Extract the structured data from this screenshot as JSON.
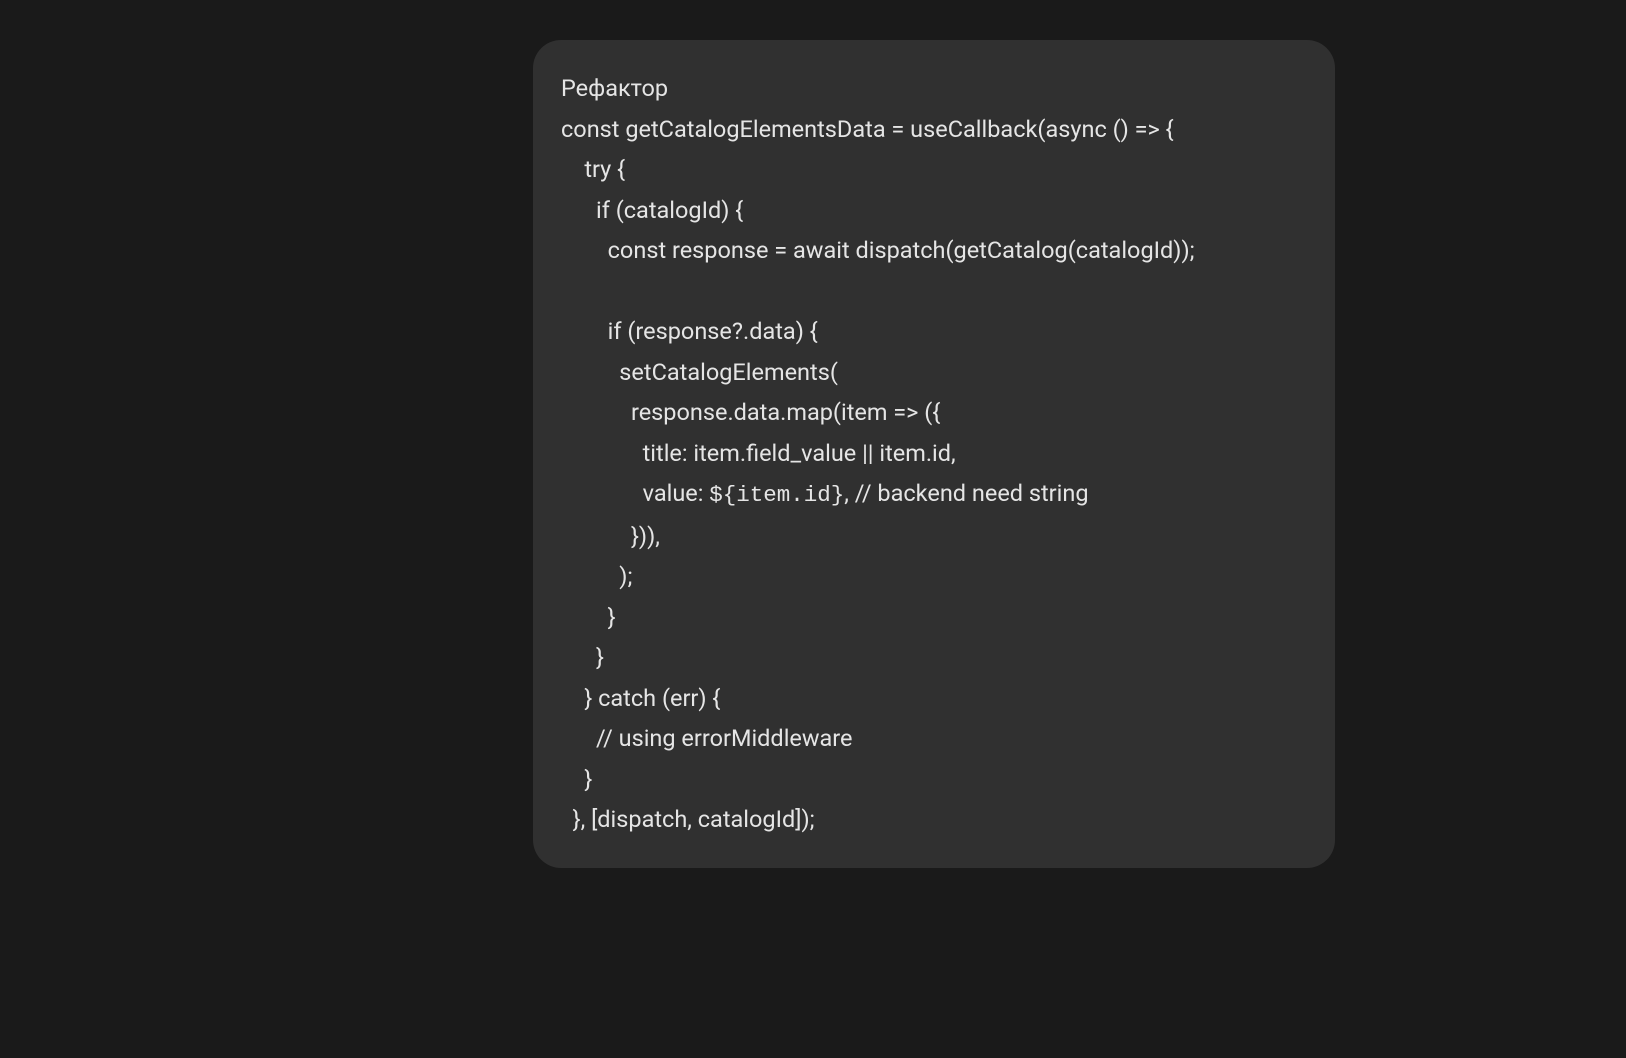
{
  "message": {
    "title": "Рефактор",
    "code_lines": [
      "const getCatalogElementsData = useCallback(async () => {",
      "    try {",
      "      if (catalogId) {",
      "        const response = await dispatch(getCatalog(catalogId));",
      "",
      "        if (response?.data) {",
      "          setCatalogElements(",
      "            response.data.map(item => ({",
      "              title: item.field_value || item.id,",
      "              value: ${item.id}, // backend need string",
      "            })),",
      "          );",
      "        }",
      "      }",
      "    } catch (err) {",
      "      // using errorMiddleware",
      "    }",
      "  }, [dispatch, catalogId]);"
    ],
    "template_literal": "${item.id}"
  }
}
